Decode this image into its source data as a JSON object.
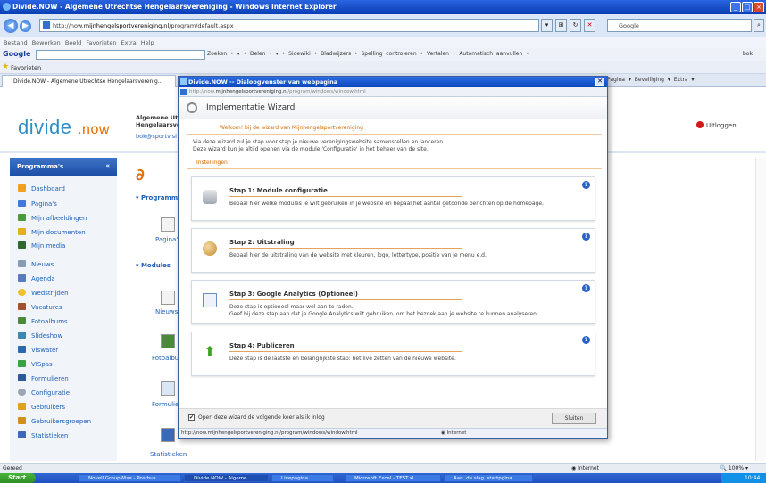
{
  "window": {
    "title": "Divide.NOW - Algemene Utrechtse Hengelaarsvereniging - Windows Internet Explorer",
    "buttons": [
      "_",
      "□",
      "×"
    ]
  },
  "address": {
    "url_prefix": "http://now.",
    "url_domain": "mijnhengelsportvereniging.nl",
    "url_path": "/program/default.aspx",
    "search_placeholder": "Google"
  },
  "menu": {
    "items": [
      "Bestand",
      "Bewerken",
      "Beeld",
      "Favorieten",
      "Extra",
      "Help"
    ]
  },
  "google_toolbar": {
    "logo": "Google",
    "items": "Zoeken • ▾ • Delen • ▾ • Sidewiki • Bladwijzers • Spelling controleren • Vertalen • Automatisch aanvullen •",
    "right": "bok"
  },
  "favorites": {
    "label": "Favorieten"
  },
  "tabs": {
    "active": "Divide.NOW - Algemene Utrechtse Hengelaarsverenig...",
    "commands": "Pagina ▾  Beveiliging ▾  Extra ▾"
  },
  "site": {
    "logo_main": "divide",
    "logo_suffix": ".now",
    "org_line1": "Algemene Utr",
    "org_line2": "Hengelaarsve",
    "org_email": "bok@sportvisi",
    "logout": "Uitloggen"
  },
  "sidebar": {
    "header": "Programma's",
    "chevron": "«",
    "items": [
      {
        "label": "Dashboard",
        "color": "#f0a020"
      },
      {
        "label": "Pagina's",
        "color": "#3b7ad8"
      },
      {
        "label": "Mijn afbeeldingen",
        "color": "#4a9a3a"
      },
      {
        "label": "Mijn documenten",
        "color": "#e0b020"
      },
      {
        "label": "Mijn media",
        "color": "#2d6a2d"
      },
      {
        "label": "Nieuws",
        "color": "#8a9bb5"
      },
      {
        "label": "Agenda",
        "color": "#5a7ac0"
      },
      {
        "label": "Wedstrijden",
        "color": "#f0c030"
      },
      {
        "label": "Vacatures",
        "color": "#a0522d"
      },
      {
        "label": "Fotoalbums",
        "color": "#4a8a3a"
      },
      {
        "label": "Slideshow",
        "color": "#3a8ab0"
      },
      {
        "label": "Viswater",
        "color": "#2a6ab0"
      },
      {
        "label": "VISpas",
        "color": "#3aa040"
      },
      {
        "label": "Formulieren",
        "color": "#2a5a9a"
      },
      {
        "label": "Configuratie",
        "color": "#9aa5b5"
      },
      {
        "label": "Gebruikers",
        "color": "#e0a020"
      },
      {
        "label": "Gebruikersgroepen",
        "color": "#d09020"
      },
      {
        "label": "Statistieken",
        "color": "#3a6ab8"
      }
    ]
  },
  "main": {
    "section_programs": "Programm",
    "pages_label": "Pagina's",
    "section_modules": "Modules",
    "news_label": "Nieuws",
    "photo_label": "Fotoalbur",
    "forms_label": "Formulier",
    "stats_label": "Statistieken"
  },
  "dialog": {
    "title": "Divide.NOW -- Dialoogvenster van webpagina",
    "url_prefix": "http://now.",
    "url_domain": "mijnhengelsportvereniging.nl",
    "url_path": "/program/windows/window.html",
    "wizard_title": "Implementatie Wizard",
    "welcome": "Welkom!  bij de wizard van Mijnhengelsportvereniging",
    "desc1": "Via deze wizard zul je stap voor stap je nieuwe verenigingswebsite samenstellen en lanceren.",
    "desc2": "Deze wizard kun je altijd openen via de module 'Configuratie' in het beheer van de site.",
    "settings_label": "Instellingen",
    "steps": [
      {
        "title": "Stap 1: Module configuratie",
        "text1": "Bepaal hier welke modules je wilt gebruiken in je website en bepaal het aantal getoonde berichten op de homepage.",
        "text2": "",
        "icon": "database-icon"
      },
      {
        "title": "Stap 2: Uitstraling",
        "text1": "Bepaal hier de uitstraling van de website met kleuren, logo, lettertype, positie van je menu e.d.",
        "text2": "",
        "icon": "palette-icon"
      },
      {
        "title": "Stap 3: Google Analytics (Optioneel)",
        "text1": "Deze stap is optioneel maar wel aan te raden.",
        "text2": "Geef bij deze stap aan dat je Google Analytics wilt gebruiken, om het bezoek aan je website te kunnen analyseren.",
        "icon": "chart-icon"
      },
      {
        "title": "Stap 4: Publiceren",
        "text1": "Deze stap is de laatste en belangrijkste stap: het live zetten van de nieuwe website.",
        "text2": "",
        "icon": "arrow-up-icon"
      }
    ],
    "help": "?",
    "checkbox_label": "Open deze wizard de volgende keer als ik inlog",
    "checkbox_mark": "✔",
    "close_button": "Sluiten",
    "status_url": "http://now.mijnhengelsportvereniging.nl/program/windows/window.html",
    "status_zone": "Internet"
  },
  "statusbar": {
    "left": "Gereed",
    "zone": "Internet",
    "zoom": "100%"
  },
  "taskbar": {
    "start": "Start",
    "tasks": [
      "Novell GroupWise - Postbus",
      "Divide.NOW - Algeme...",
      "Livepagina",
      "Microsoft Excel - TEST.xl",
      "Aan. de slag. startpgina..."
    ],
    "clock": "10:44"
  }
}
